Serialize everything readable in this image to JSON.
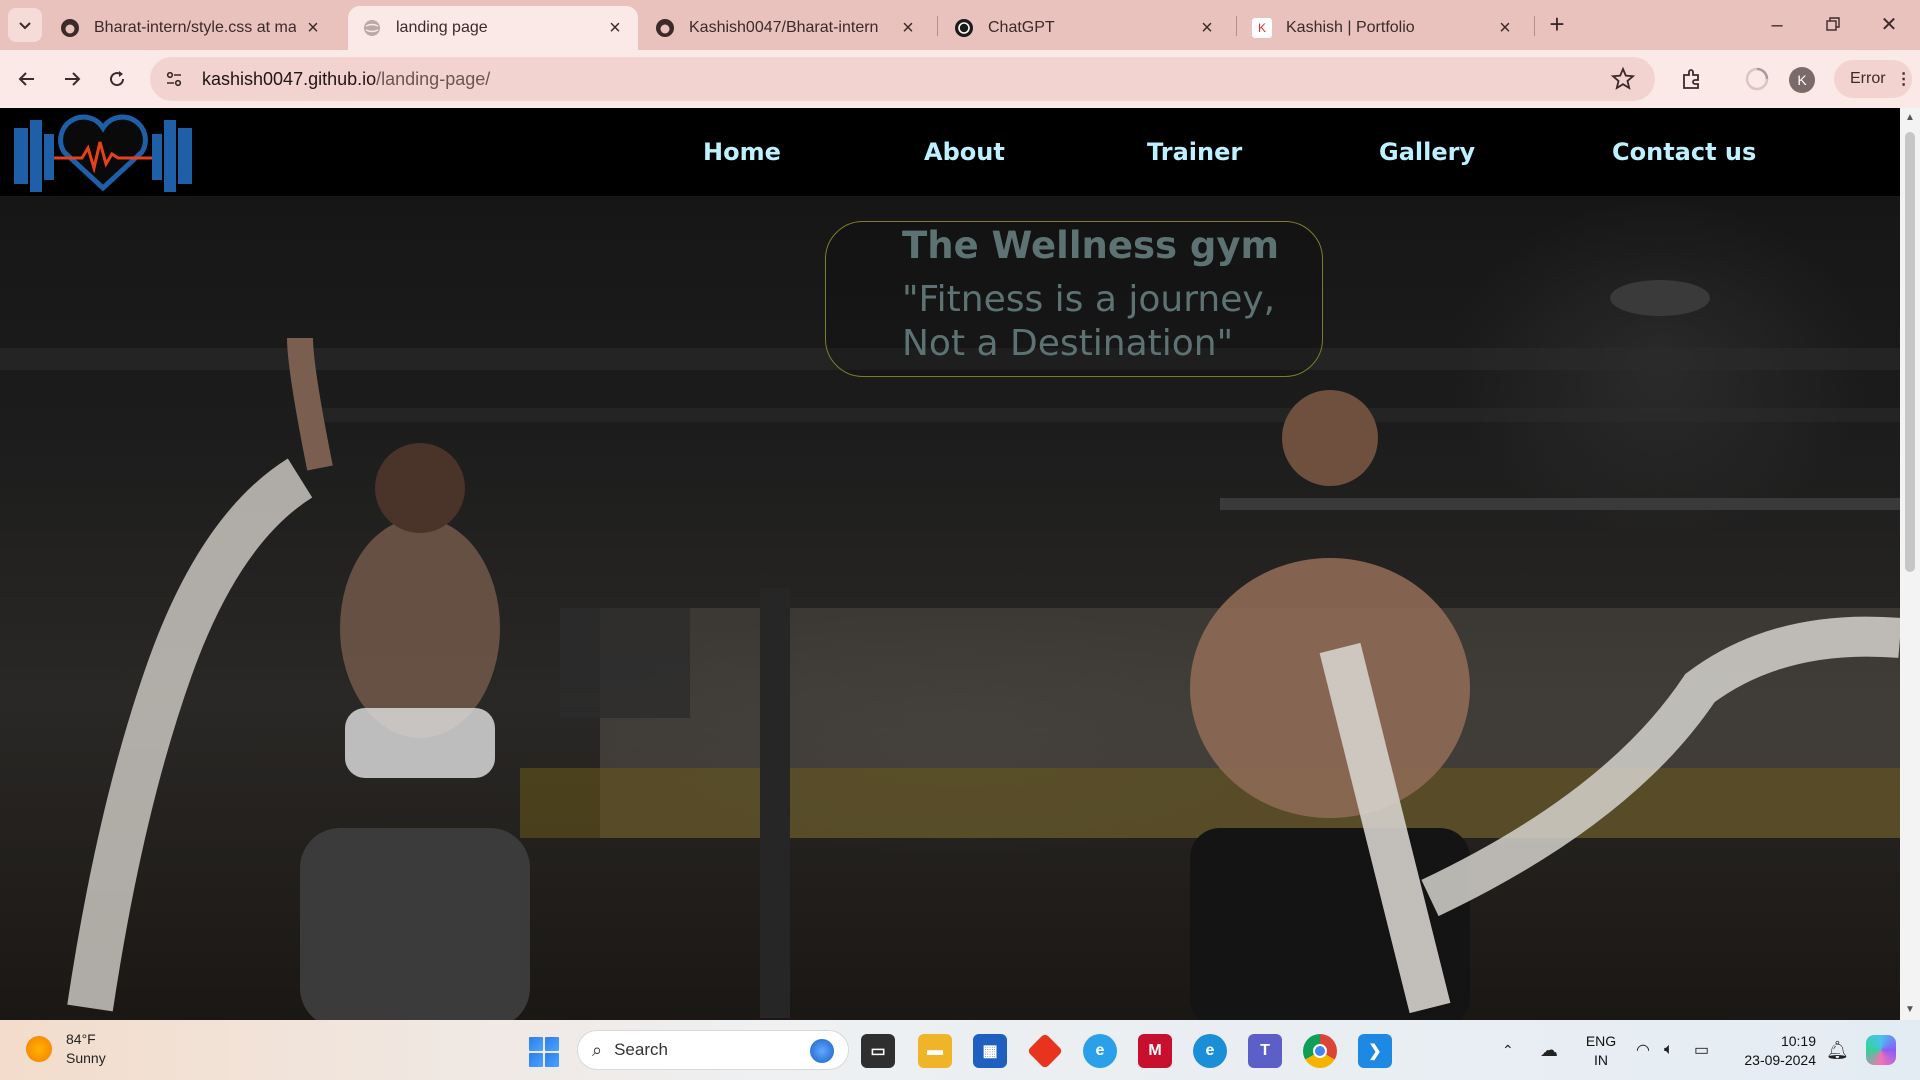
{
  "browser": {
    "tabs": [
      {
        "title": "Bharat-intern/style.css at main ·",
        "favicon": "github-icon",
        "active": false
      },
      {
        "title": "landing page",
        "favicon": "globe-icon",
        "active": true
      },
      {
        "title": "Kashish0047/Bharat-intern",
        "favicon": "github-icon",
        "active": false
      },
      {
        "title": "ChatGPT",
        "favicon": "chatgpt-icon",
        "active": false
      },
      {
        "title": "Kashish | Portfolio",
        "favicon": "k-icon",
        "active": false
      }
    ],
    "url_host": "kashish0047.github.io",
    "url_path": "/landing-page/",
    "profile_initial": "K",
    "error_label": "Error"
  },
  "site": {
    "nav": [
      "Home",
      "About",
      "Trainer",
      "Gallery",
      "Contact us"
    ],
    "hero_title": "The Wellness gym",
    "hero_quote": "\"Fitness is a journey, Not a Destination\"",
    "colors": {
      "nav_text": "#bdf1ff",
      "hero_text": "#5d7373",
      "card_border": "#7e7d2a",
      "logo_blue": "#1f5fa8",
      "logo_pulse": "#e8401c"
    }
  },
  "taskbar": {
    "temperature": "84°F",
    "condition": "Sunny",
    "search_placeholder": "Search",
    "language_line1": "ENG",
    "language_line2": "IN",
    "time": "10:19",
    "date": "23-09-2024"
  }
}
